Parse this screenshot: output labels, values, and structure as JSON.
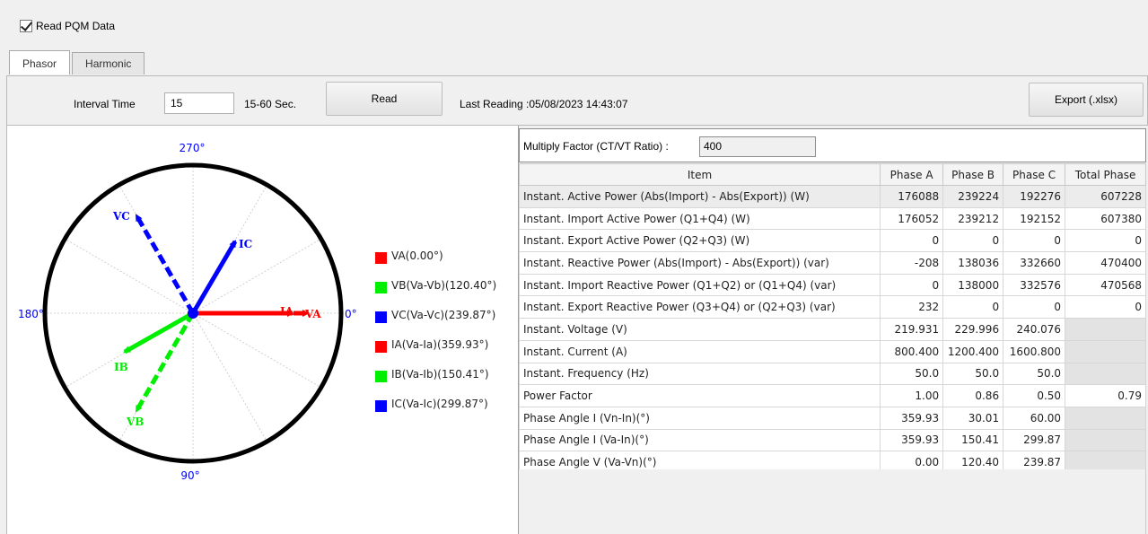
{
  "header": {
    "read_pqm_checkbox_label": "Read PQM Data",
    "read_pqm_checked": true
  },
  "tabs": [
    {
      "label": "Phasor",
      "active": true
    },
    {
      "label": "Harmonic",
      "active": false
    }
  ],
  "toolbar": {
    "interval_label": "Interval Time",
    "interval_value": "15",
    "range_label": "15-60  Sec.",
    "read_button": "Read",
    "last_reading": "Last Reading :05/08/2023 14:43:07",
    "export_button": "Export (.xlsx)"
  },
  "phasor": {
    "angle_labels": {
      "top": "270°",
      "bottom": "90°",
      "left": "180°",
      "right": "0°"
    },
    "vector_labels": {
      "va": "VA",
      "vb": "VB",
      "vc": "VC",
      "ia": "IA",
      "ib": "IB",
      "ic": "IC"
    },
    "colors": {
      "va": "#ff0000",
      "vb": "#00ee00",
      "vc": "#0000ff",
      "ia": "#ff0000",
      "ib": "#00ee00",
      "ic": "#0000ff"
    },
    "legend": [
      {
        "label": "VA(0.00°)",
        "color": "#ff0000"
      },
      {
        "label": "VB(Va-Vb)(120.40°)",
        "color": "#00ee00"
      },
      {
        "label": "VC(Va-Vc)(239.87°)",
        "color": "#0000ff"
      },
      {
        "label": "IA(Va-Ia)(359.93°)",
        "color": "#ff0000"
      },
      {
        "label": "IB(Va-Ib)(150.41°)",
        "color": "#00ee00"
      },
      {
        "label": "IC(Va-Ic)(299.87°)",
        "color": "#0000ff"
      }
    ]
  },
  "multiply_factor": {
    "label": "Multiply Factor (CT/VT Ratio) :",
    "value": "400"
  },
  "table": {
    "columns": [
      "Item",
      "Phase A",
      "Phase B",
      "Phase C",
      "Total Phase"
    ],
    "rows": [
      [
        "Instant. Active Power (Abs(Import) - Abs(Export)) (W)",
        "176088",
        "239224",
        "192276",
        "607228"
      ],
      [
        "Instant. Import Active Power (Q1+Q4) (W)",
        "176052",
        "239212",
        "192152",
        "607380"
      ],
      [
        "Instant. Export Active Power (Q2+Q3) (W)",
        "0",
        "0",
        "0",
        "0"
      ],
      [
        "Instant. Reactive Power (Abs(Import) - Abs(Export)) (var)",
        "-208",
        "138036",
        "332660",
        "470400"
      ],
      [
        "Instant. Import Reactive Power (Q1+Q2) or (Q1+Q4) (var)",
        "0",
        "138000",
        "332576",
        "470568"
      ],
      [
        "Instant. Export Reactive Power (Q3+Q4) or (Q2+Q3) (var)",
        "232",
        "0",
        "0",
        "0"
      ],
      [
        "Instant. Voltage (V)",
        "219.931",
        "229.996",
        "240.076",
        ""
      ],
      [
        "Instant. Current (A)",
        "800.400",
        "1200.400",
        "1600.800",
        ""
      ],
      [
        "Instant. Frequency (Hz)",
        "50.0",
        "50.0",
        "50.0",
        ""
      ],
      [
        "Power Factor",
        "1.00",
        "0.86",
        "0.50",
        "0.79"
      ],
      [
        "Phase Angle I (Vn-In)(°)",
        "359.93",
        "30.01",
        "60.00",
        ""
      ],
      [
        "Phase Angle I (Va-In)(°)",
        "359.93",
        "150.41",
        "299.87",
        ""
      ],
      [
        "Phase Angle V (Va-Vn)(°)",
        "0.00",
        "120.40",
        "239.87",
        ""
      ]
    ]
  }
}
